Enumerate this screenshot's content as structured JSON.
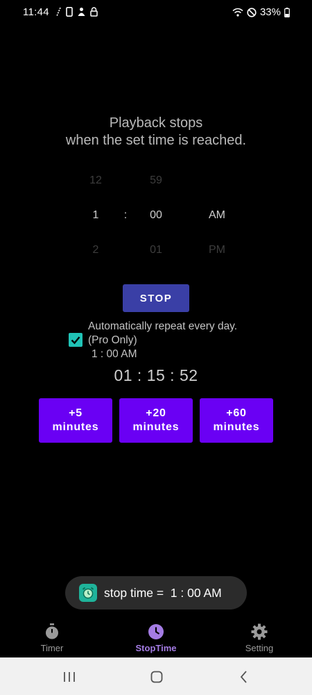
{
  "status_bar": {
    "time": "11:44",
    "battery": "33%"
  },
  "headline": {
    "line1": "Playback stops",
    "line2": "when the set time is reached."
  },
  "picker": {
    "hours": [
      "12",
      "1",
      "2"
    ],
    "separator": ":",
    "minutes": [
      "59",
      "00",
      "01"
    ],
    "ampm": [
      "",
      "AM",
      "PM"
    ]
  },
  "stop_button": "STOP",
  "repeat": {
    "checked": true,
    "line1": "Automatically repeat every day.",
    "line2": "(Pro Only)",
    "time": "1 : 00 AM"
  },
  "countdown": "01 : 15 : 52",
  "add_buttons": [
    {
      "amount": "+5",
      "unit": "minutes"
    },
    {
      "amount": "+20",
      "unit": "minutes"
    },
    {
      "amount": "+60",
      "unit": "minutes"
    }
  ],
  "toast": {
    "icon": "alarm-clock-icon",
    "text": "stop time =  1 : 00 AM"
  },
  "bottom_nav": [
    {
      "label": "Timer",
      "icon": "stopwatch-icon",
      "active": false
    },
    {
      "label": "StopTime",
      "icon": "clock-icon",
      "active": true
    },
    {
      "label": "Setting",
      "icon": "gear-icon",
      "active": false
    }
  ],
  "colors": {
    "background": "#000000",
    "stop_button": "#3a3fa6",
    "add_button": "#6a00f4",
    "checkbox": "#20c3b6",
    "nav_active": "#a47ce4"
  }
}
